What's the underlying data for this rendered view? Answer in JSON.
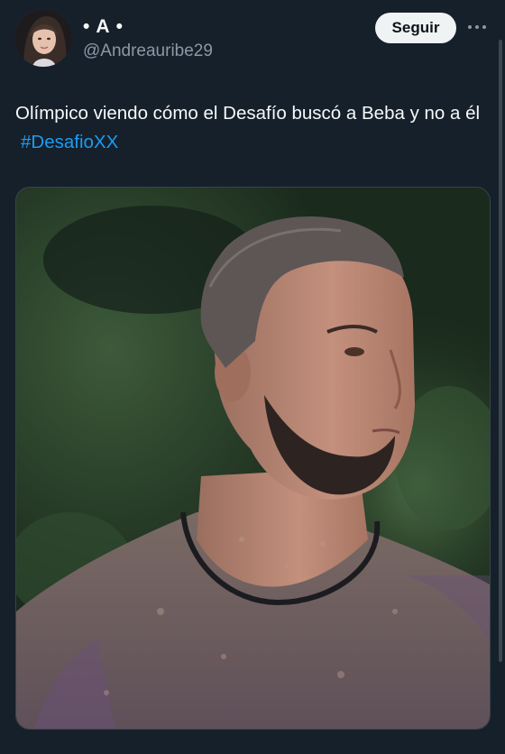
{
  "tweet": {
    "author": {
      "display_name": "• A •",
      "handle": "@Andreauribe29",
      "avatar_icon": "user-avatar"
    },
    "follow_label": "Seguir",
    "more_icon": "more-horizontal-icon",
    "text": "Olímpico viendo cómo el Desafío buscó a Beba y no a él",
    "hashtag": "#DesafioXX",
    "media": {
      "type": "photo"
    }
  },
  "colors": {
    "background": "#15202b",
    "link": "#1d9bf0",
    "secondary_text": "#8b98a5",
    "button_bg": "#eff3f4"
  }
}
